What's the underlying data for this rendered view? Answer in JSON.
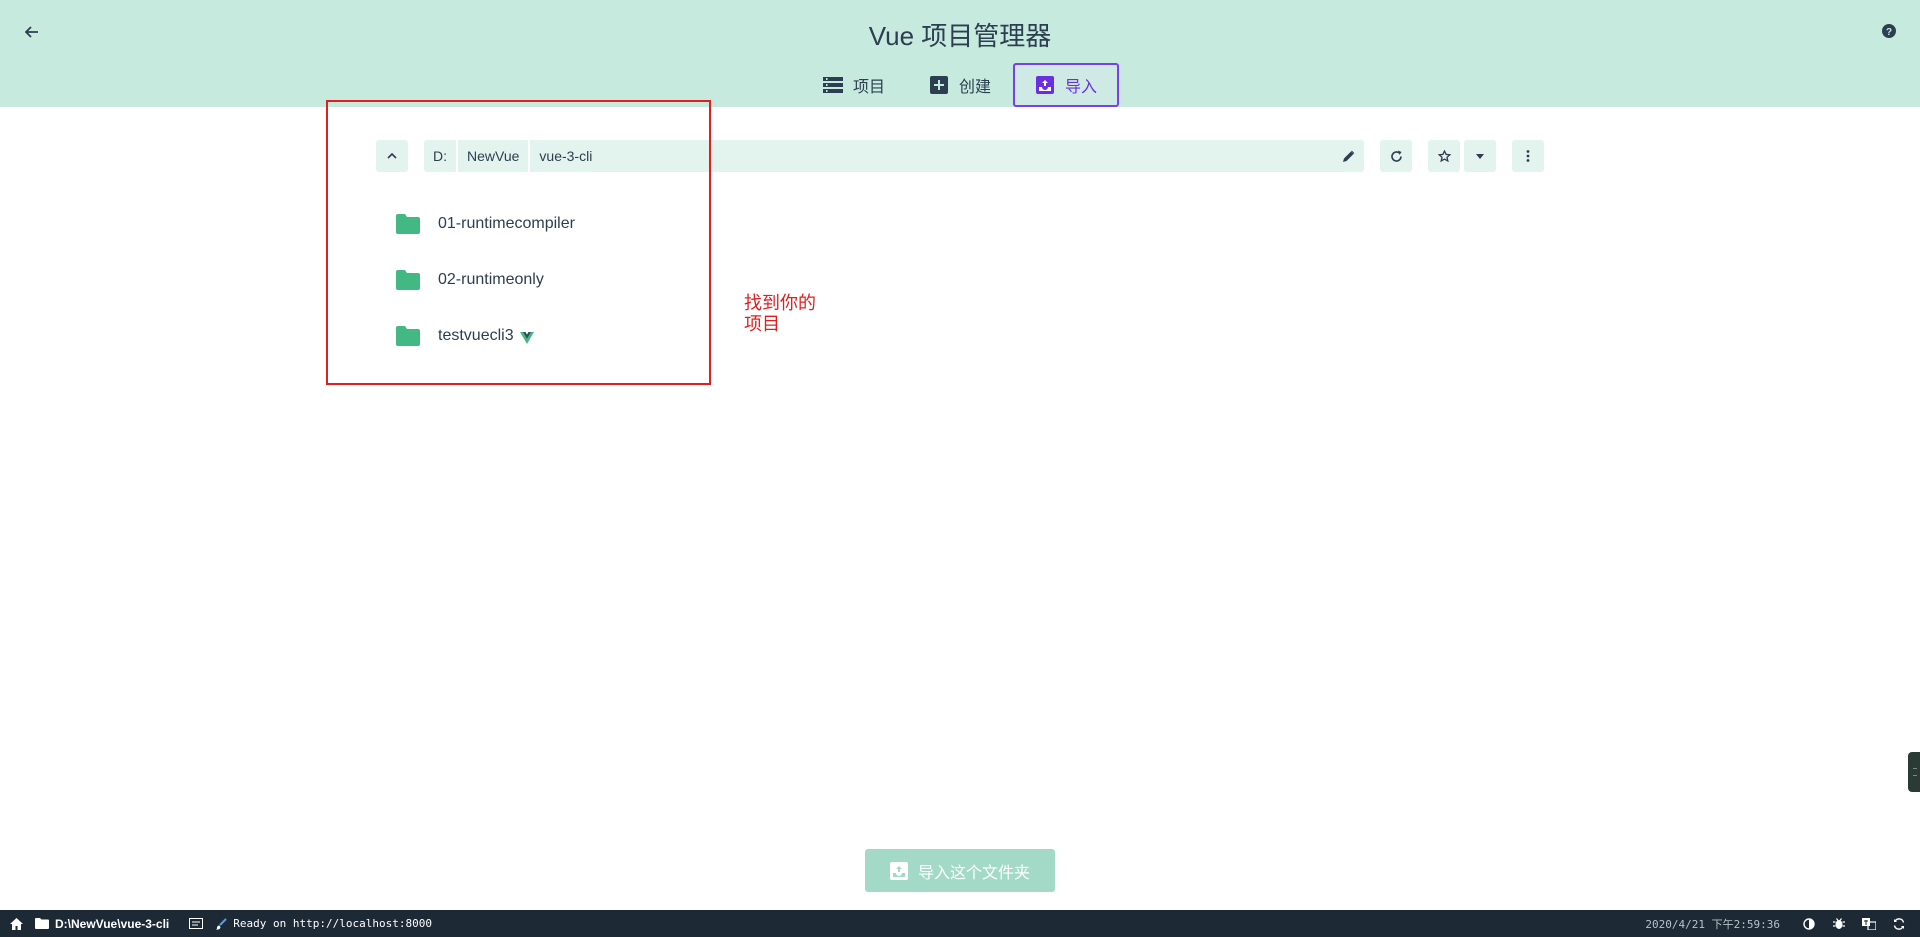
{
  "header": {
    "title": "Vue 项目管理器",
    "tabs": [
      {
        "label": "项目",
        "icon": "list-icon",
        "active": false
      },
      {
        "label": "创建",
        "icon": "add-box-icon",
        "active": false
      },
      {
        "label": "导入",
        "icon": "import-icon",
        "active": true
      }
    ]
  },
  "path": {
    "crumbs": [
      "D:",
      "NewVue",
      "vue-3-cli"
    ]
  },
  "folders": [
    {
      "name": "01-runtimecompiler",
      "is_vue_project": false
    },
    {
      "name": "02-runtimeonly",
      "is_vue_project": false
    },
    {
      "name": "testvuecli3",
      "is_vue_project": true
    }
  ],
  "annotation": {
    "line1": "找到你的",
    "line2": "项目",
    "color": "#e02020"
  },
  "import_button": {
    "label": "导入这个文件夹"
  },
  "statusbar": {
    "cwd": "D:\\NewVue\\vue-3-cli",
    "log": "Ready on http://localhost:8000",
    "datetime": "2020/4/21 下午2:59:36"
  },
  "colors": {
    "header_bg": "#c7eadf",
    "accent": "#42b983",
    "active_tab_border": "#7a3df0",
    "statusbar_bg": "#1d2935"
  }
}
